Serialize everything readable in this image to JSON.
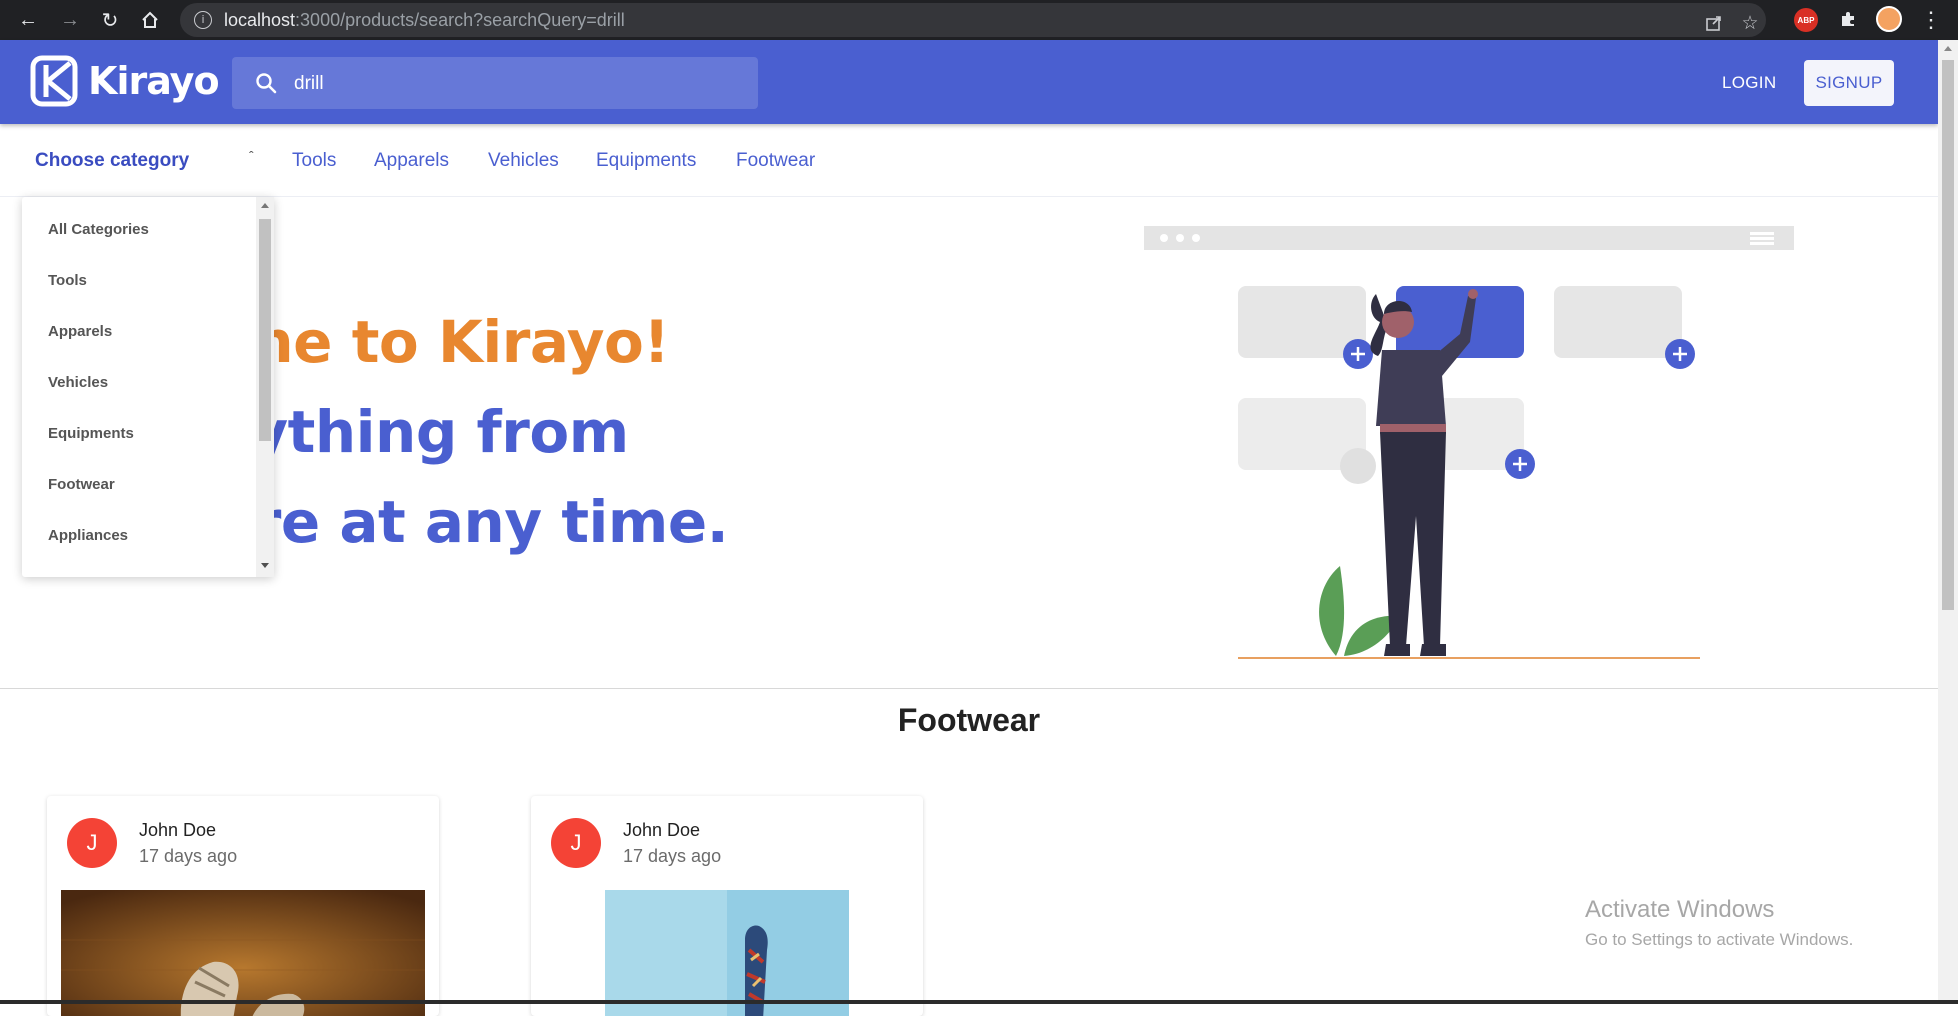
{
  "browser": {
    "url_host": "localhost",
    "url_path": ":3000/products/search?searchQuery=drill",
    "abp_label": "ABP"
  },
  "header": {
    "brand": "Kirayo",
    "search_value": "drill",
    "login_label": "LOGIN",
    "signup_label": "SIGNUP",
    "brand_color": "#4a5fd0"
  },
  "catbar": {
    "choose_label": "Choose category",
    "links": [
      "Tools",
      "Apparels",
      "Vehicles",
      "Equipments",
      "Footwear"
    ]
  },
  "dropdown": {
    "items": [
      "All Categories",
      "Tools",
      "Apparels",
      "Vehicles",
      "Equipments",
      "Footwear",
      "Appliances"
    ]
  },
  "hero": {
    "line1": "come to Kirayo!",
    "line2": "t anything from",
    "line3": "where at any time.",
    "line1_color": "#e8872f",
    "accent_color": "#4a5fd0"
  },
  "section": {
    "title": "Footwear"
  },
  "cards": [
    {
      "initial": "J",
      "user": "John Doe",
      "when": "17 days ago"
    },
    {
      "initial": "J",
      "user": "John Doe",
      "when": "17 days ago"
    }
  ],
  "watermark": {
    "line1": "Activate Windows",
    "line2": "Go to Settings to activate Windows."
  }
}
